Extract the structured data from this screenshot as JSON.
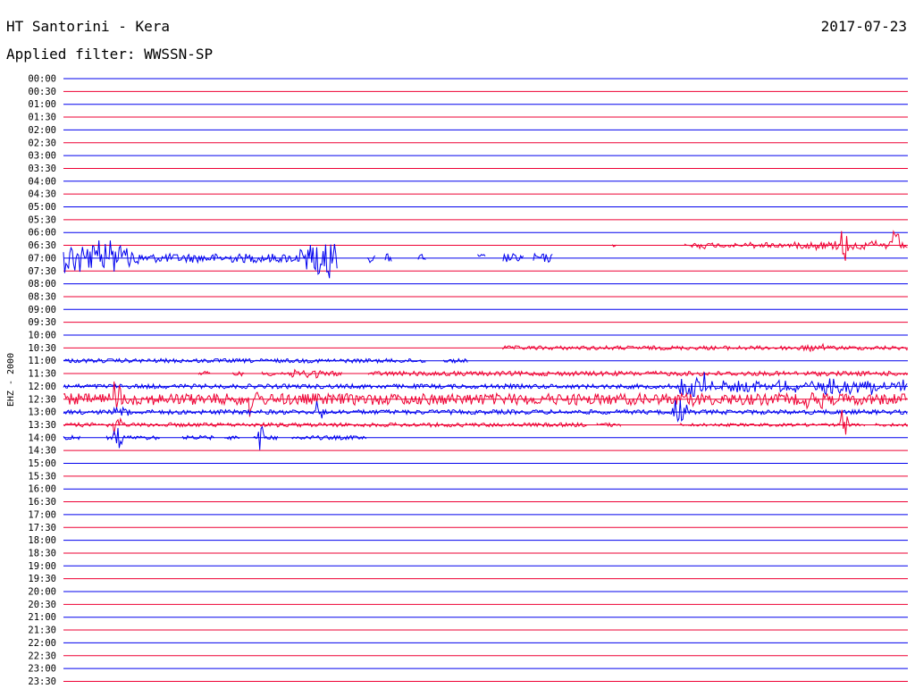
{
  "header": {
    "title": "HT Santorini - Kera",
    "date": "2017-07-23",
    "filter": "Applied filter: WWSSN-SP"
  },
  "chart_data": {
    "type": "line",
    "title": "HT Santorini - Kera",
    "subtitle": "Applied filter: WWSSN-SP",
    "date": "2017-07-23",
    "ylabel": "EHZ - 2000",
    "xlabel": "",
    "row_labels": [
      "00:00",
      "00:30",
      "01:00",
      "01:30",
      "02:00",
      "02:30",
      "03:00",
      "03:30",
      "04:00",
      "04:30",
      "05:00",
      "05:30",
      "06:00",
      "06:30",
      "07:00",
      "07:30",
      "08:00",
      "08:30",
      "09:00",
      "09:30",
      "10:00",
      "10:30",
      "11:00",
      "11:30",
      "12:00",
      "12:30",
      "13:00",
      "13:30",
      "14:00",
      "14:30",
      "15:00",
      "15:30",
      "16:00",
      "16:30",
      "17:00",
      "17:30",
      "18:00",
      "18:30",
      "19:00",
      "19:30",
      "20:00",
      "20:30",
      "21:00",
      "21:30",
      "22:00",
      "22:30",
      "23:00",
      "23:30"
    ],
    "colors": {
      "even": "#0000ee",
      "odd": "#ee0033"
    },
    "x_range_minutes": [
      0,
      30
    ],
    "traces": [
      {
        "row": "07:00",
        "start": 0.0,
        "end": 0.58,
        "amp": 0.35,
        "bursts": [
          [
            0.0,
            0.06,
            1.5
          ],
          [
            0.04,
            0.09,
            1.2
          ],
          [
            0.28,
            0.33,
            1.4
          ],
          [
            0.29,
            0.33,
            1.8
          ]
        ],
        "gaps": [
          [
            0.325,
            0.36
          ],
          [
            0.37,
            0.38
          ],
          [
            0.39,
            0.42
          ],
          [
            0.43,
            0.49
          ],
          [
            0.5,
            0.52
          ],
          [
            0.545,
            0.555
          ]
        ]
      },
      {
        "row": "06:30",
        "start": 0.65,
        "end": 1.0,
        "amp": 0.12,
        "bursts": [
          [
            0.72,
            0.88,
            0.3
          ],
          [
            0.88,
            1.0,
            0.45
          ],
          [
            0.92,
            0.93,
            1.6
          ],
          [
            0.98,
            0.99,
            1.2
          ]
        ],
        "gaps": [
          [
            0.655,
            0.735
          ]
        ]
      },
      {
        "row": "10:30",
        "start": 0.52,
        "end": 1.0,
        "amp": 0.16,
        "bursts": [
          [
            0.87,
            0.9,
            0.35
          ]
        ],
        "gaps": []
      },
      {
        "row": "11:00",
        "start": 0.0,
        "end": 0.48,
        "amp": 0.16,
        "bursts": [],
        "gaps": [
          [
            0.43,
            0.45
          ]
        ]
      },
      {
        "row": "11:30",
        "start": 0.16,
        "end": 1.0,
        "amp": 0.18,
        "bursts": [
          [
            0.27,
            0.31,
            0.5
          ],
          [
            0.42,
            0.45,
            0.3
          ]
        ],
        "gaps": [
          [
            0.175,
            0.2
          ],
          [
            0.215,
            0.235
          ],
          [
            0.33,
            0.36
          ]
        ]
      },
      {
        "row": "12:00",
        "start": 0.0,
        "end": 1.0,
        "amp": 0.18,
        "bursts": [
          [
            0.73,
            0.76,
            1.5
          ],
          [
            0.75,
            0.9,
            0.55
          ],
          [
            0.9,
            1.0,
            0.7
          ]
        ],
        "gaps": []
      },
      {
        "row": "12:30",
        "start": 0.0,
        "end": 1.0,
        "amp": 0.45,
        "bursts": [
          [
            0.06,
            0.07,
            1.6
          ],
          [
            0.22,
            0.23,
            1.8
          ],
          [
            0.72,
            0.76,
            0.6
          ],
          [
            0.88,
            0.9,
            0.9
          ]
        ],
        "gaps": []
      },
      {
        "row": "13:00",
        "start": 0.0,
        "end": 1.0,
        "amp": 0.18,
        "bursts": [
          [
            0.06,
            0.08,
            0.5
          ],
          [
            0.72,
            0.74,
            1.2
          ],
          [
            0.3,
            0.31,
            1.1
          ]
        ],
        "gaps": []
      },
      {
        "row": "13:30",
        "start": 0.0,
        "end": 0.66,
        "amp": 0.16,
        "bursts": [
          [
            0.06,
            0.07,
            1.3
          ]
        ],
        "gaps": [
          [
            0.62,
            0.63
          ]
        ]
      },
      {
        "row": "13:30",
        "start": 0.73,
        "end": 1.0,
        "amp": 0.12,
        "bursts": [
          [
            0.92,
            0.93,
            1.6
          ]
        ],
        "gaps": [
          [
            0.95,
            0.96
          ]
        ]
      },
      {
        "row": "14:00",
        "start": 0.0,
        "end": 0.36,
        "amp": 0.16,
        "bursts": [
          [
            0.06,
            0.07,
            1.0
          ],
          [
            0.23,
            0.24,
            1.5
          ]
        ],
        "gaps": [
          [
            0.02,
            0.05
          ],
          [
            0.115,
            0.14
          ],
          [
            0.18,
            0.19
          ],
          [
            0.21,
            0.225
          ],
          [
            0.255,
            0.27
          ]
        ]
      }
    ]
  }
}
